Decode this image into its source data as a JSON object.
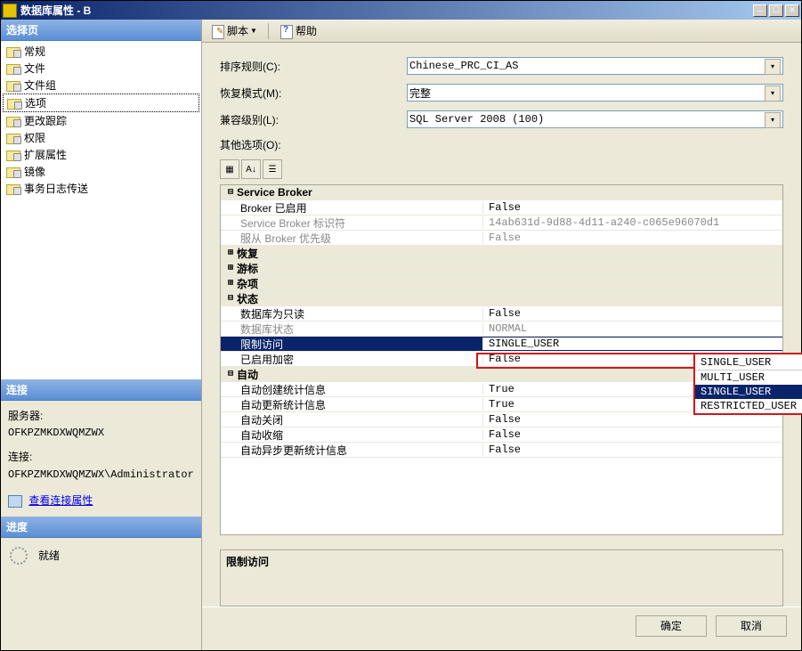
{
  "titlebar": {
    "text": "数据库属性 - B"
  },
  "sidebar": {
    "select_page_header": "选择页",
    "items": [
      {
        "label": "常规"
      },
      {
        "label": "文件"
      },
      {
        "label": "文件组"
      },
      {
        "label": "选项",
        "selected": true
      },
      {
        "label": "更改跟踪"
      },
      {
        "label": "权限"
      },
      {
        "label": "扩展属性"
      },
      {
        "label": "镜像"
      },
      {
        "label": "事务日志传送"
      }
    ],
    "conn_header": "连接",
    "server_label": "服务器:",
    "server_value": "OFKPZMKDXWQMZWX",
    "conn_label": "连接:",
    "conn_value": "OFKPZMKDXWQMZWX\\Administrator",
    "view_conn_link": "查看连接属性",
    "progress_header": "进度",
    "progress_status": "就绪"
  },
  "toolbar": {
    "script": "脚本",
    "help": "帮助"
  },
  "form": {
    "collation_label": "排序规则(C):",
    "collation_value": "Chinese_PRC_CI_AS",
    "recovery_label": "恢复模式(M):",
    "recovery_value": "完整",
    "compat_label": "兼容级别(L):",
    "compat_value": "SQL Server 2008 (100)",
    "other_label": "其他选项(O):"
  },
  "grid": {
    "categories": {
      "service_broker": "Service Broker",
      "recovery": "恢复",
      "cursor": "游标",
      "misc": "杂项",
      "state": "状态",
      "auto": "自动"
    },
    "rows": {
      "broker_enabled": {
        "label": "Broker 已启用",
        "value": "False"
      },
      "broker_id": {
        "label": "Service Broker 标识符",
        "value": "14ab631d-9d88-4d11-a240-c065e96070d1"
      },
      "honor_priority": {
        "label": "服从 Broker 优先级",
        "value": "False"
      },
      "readonly": {
        "label": "数据库为只读",
        "value": "False"
      },
      "db_state": {
        "label": "数据库状态",
        "value": "NORMAL"
      },
      "restrict": {
        "label": "限制访问",
        "value": "SINGLE_USER"
      },
      "encrypt": {
        "label": "已启用加密",
        "value": "False"
      },
      "auto_create_stats": {
        "label": "自动创建统计信息",
        "value": "True"
      },
      "auto_update_stats": {
        "label": "自动更新统计信息",
        "value": "True"
      },
      "auto_close": {
        "label": "自动关闭",
        "value": "False"
      },
      "auto_shrink": {
        "label": "自动收缩",
        "value": "False"
      },
      "auto_async_stats": {
        "label": "自动异步更新统计信息",
        "value": "False"
      }
    },
    "dropdown": {
      "current": "SINGLE_USER",
      "options": [
        "MULTI_USER",
        "SINGLE_USER",
        "RESTRICTED_USER"
      ],
      "highlighted": "SINGLE_USER"
    }
  },
  "desc": {
    "title": "限制访问"
  },
  "footer": {
    "ok": "确定",
    "cancel": "取消"
  }
}
